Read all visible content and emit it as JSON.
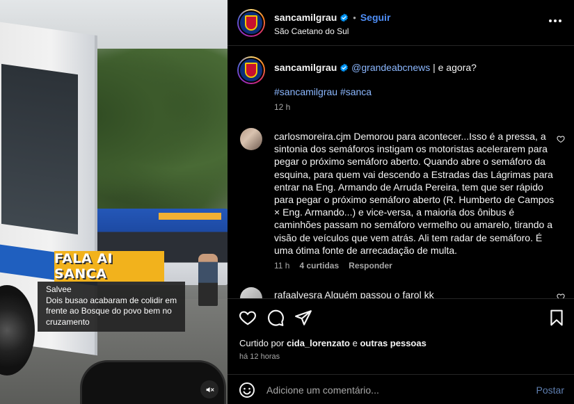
{
  "media": {
    "sticker_text": "FALA AI SANCA",
    "caption_lines": [
      "Salvee",
      "Dois busao acabaram de colidir em",
      "frente ao Bosque do povo bem no",
      "cruzamento"
    ],
    "mute_icon": "speaker-muted-icon"
  },
  "header": {
    "username": "sancamilgrau",
    "follow_label": "Seguir",
    "location": "São Caetano do Sul",
    "separator": "•"
  },
  "post": {
    "username": "sancamilgrau",
    "mention": "@grandeabcnews",
    "text": " | e agora?",
    "hashtags": "#sancamilgrau #sanca",
    "time": "12 h"
  },
  "comments": [
    {
      "username": "carlosmoreira.cjm",
      "text": "Demorou para acontecer...Isso é a pressa, a sintonia dos semáforos instigam os motoristas acelerarem para pegar o próximo semáforo aberto. Quando abre o semáforo da esquina, para quem vai descendo a Estradas das Lágrimas para entrar na Eng. Armando de Arruda Pereira, tem que ser rápido para pegar o próximo semáforo aberto (R. Humberto de Campos × Eng. Armando...) e vice-versa, a maioria dos ônibus é caminhões passam no semáforo vermelho ou amarelo, tirando a visão de veículos que vem atrás. Ali tem radar de semáforo. É uma ótima fonte de arrecadação de multa.",
      "time": "11 h",
      "likes": "4 curtidas",
      "reply": "Responder"
    },
    {
      "username": "rafaalvesra",
      "text": "Alguém passou o farol kk"
    }
  ],
  "likes": {
    "prefix": "Curtido por",
    "user": "cida_lorenzato",
    "connector": "e",
    "others": "outras pessoas"
  },
  "posted_ago": "há 12 horas",
  "add_comment": {
    "placeholder": "Adicione um comentário...",
    "post_label": "Postar"
  },
  "colors": {
    "link": "#4f8ff7",
    "mention": "#8cb8ff",
    "muted": "#a8a8a8",
    "sticker": "#f2b21c"
  }
}
